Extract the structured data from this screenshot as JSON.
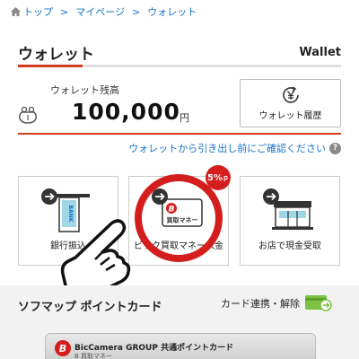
{
  "breadcrumb": {
    "items": [
      "トップ",
      "マイページ",
      "ウォレット"
    ],
    "separator": ">"
  },
  "header": {
    "title": "ウォレット",
    "title_en": "Wallet"
  },
  "balance": {
    "label": "ウォレット残高",
    "amount": "100,000",
    "unit": "円",
    "icon": "purse-icon"
  },
  "history_button": {
    "label": "ウォレット履歴",
    "icon": "yen-history-icon"
  },
  "withdraw_notice": {
    "text": "ウォレットから引き出し前にご確認ください",
    "icon": "help-icon",
    "glyph": "?"
  },
  "actions": [
    {
      "label": "銀行振込",
      "icon": "bank-transfer-icon"
    },
    {
      "label": "ビック買取マネー入金",
      "icon": "bic-money-icon",
      "badge": "5%",
      "badge_unit": "ｐ"
    },
    {
      "label": "お店で現金受取",
      "icon": "store-icon"
    }
  ],
  "bic_card_face": {
    "logo_letter": "B",
    "text": "買取マネー"
  },
  "point_card_section": {
    "title": "ソフマップ ポイントカード",
    "link_label": "カード連携・解除",
    "link_icon": "card-link-icon"
  },
  "point_card": {
    "logo_letter": "B",
    "brand": "BicCamera GROUP 共通ポイントカード",
    "sub": "B 買取マネー"
  },
  "colors": {
    "accent_red": "#d43a24",
    "link_blue": "#1a73c8",
    "badge_red": "#d41e1e"
  }
}
